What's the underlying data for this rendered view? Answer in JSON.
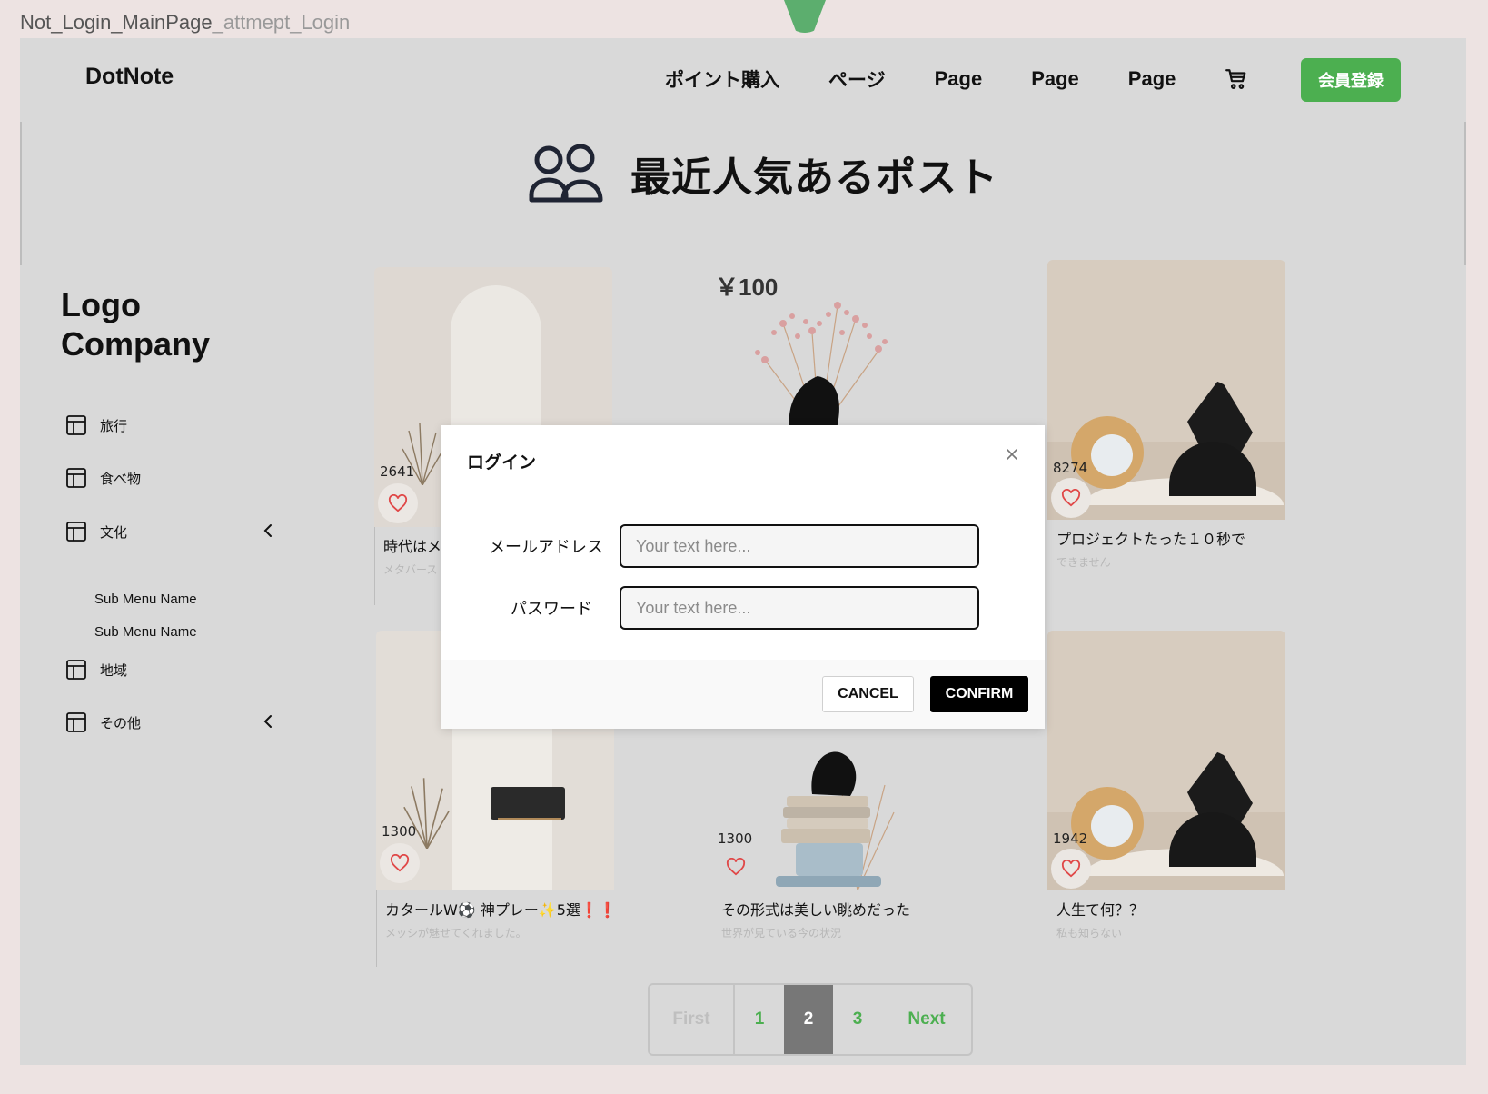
{
  "frame": {
    "name": "Not_Login_MainPage",
    "suffix": "_attmept_Login"
  },
  "header": {
    "brand": "DotNote",
    "nav": [
      "ポイント購入",
      "ページ",
      "Page",
      "Page",
      "Page"
    ],
    "signup_label": "会員登録"
  },
  "hero": {
    "title": "最近人気あるポスト"
  },
  "sidebar": {
    "logo": "Logo\nCompany",
    "items": [
      "旅行",
      "食べ物",
      "文化",
      "地域",
      "その他"
    ],
    "submenu": [
      "Sub Menu Name",
      "Sub Menu Name"
    ]
  },
  "price_label": "￥100",
  "cards": [
    {
      "likes": "2641",
      "title": "時代はメ",
      "subtitle": "メタバース"
    },
    {
      "likes": "8274",
      "title": "プロジェクトたった１０秒で",
      "subtitle": "できません"
    },
    {
      "likes": "1300",
      "title": "カタールW⚽️ 神プレー✨5選❗️❗️",
      "subtitle": "メッシが魅せてくれました。"
    },
    {
      "likes": "1300",
      "title": "その形式は美しい眺めだった",
      "subtitle": "世界が見ている今の状況"
    },
    {
      "likes": "1942",
      "title": "人生て何？？",
      "subtitle": "私も知らない"
    }
  ],
  "pagination": {
    "first": "First",
    "pages": [
      "1",
      "2",
      "3"
    ],
    "active": "2",
    "next": "Next"
  },
  "modal": {
    "title": "ログイン",
    "email_label": "メールアドレス",
    "email_placeholder": "Your text here...",
    "password_label": "パスワード",
    "password_placeholder": "Your text here...",
    "cancel_label": "CANCEL",
    "confirm_label": "CONFIRM"
  },
  "colors": {
    "accent": "#4caf50",
    "canvas": "#d9d9d9",
    "page": "#ede3e2",
    "heart": "#e04848"
  }
}
